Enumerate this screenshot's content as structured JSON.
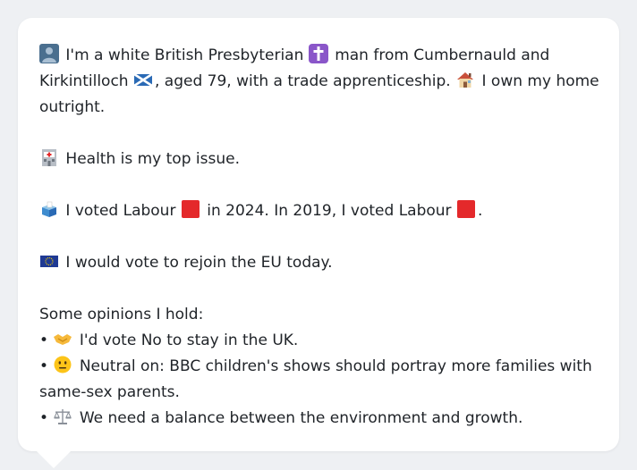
{
  "lines": {
    "l1_a": "I'm a white British Presbyterian",
    "l1_b": "man from Cumbernauld and",
    "l2_a": "Kirkintilloch",
    "l2_b": ", aged 79, with a trade apprenticeship.",
    "l2_c": "I own my home",
    "l3": "outright.",
    "health": "Health is my top issue.",
    "vote_a": "I voted Labour",
    "vote_b": "in 2024. In 2019, I voted Labour",
    "vote_c": ".",
    "eu": "I would vote to rejoin the EU today.",
    "opinions_header": "Some opinions I hold:",
    "op1": "I'd vote No to stay in the UK.",
    "op2_a": "Neutral on: BBC children's shows should portray more families with",
    "op2_b": "same-sex parents.",
    "op3": "We need a balance between the environment and growth."
  },
  "bullet": "•",
  "icons": [
    "person-icon",
    "cross-icon",
    "saltire-flag-icon",
    "house-icon",
    "hospital-icon",
    "ballot-box-icon",
    "labour-red-square-icon",
    "eu-flag-icon",
    "handshake-icon",
    "neutral-face-icon",
    "balance-scale-icon"
  ],
  "colors": {
    "background": "#eef0f3",
    "bubble": "#ffffff",
    "text": "#1f2328",
    "labour_red": "#e4292b",
    "cross_purple": "#8a56c9",
    "eu_blue": "#1f3a93",
    "saltire_blue": "#2a6ab5"
  }
}
